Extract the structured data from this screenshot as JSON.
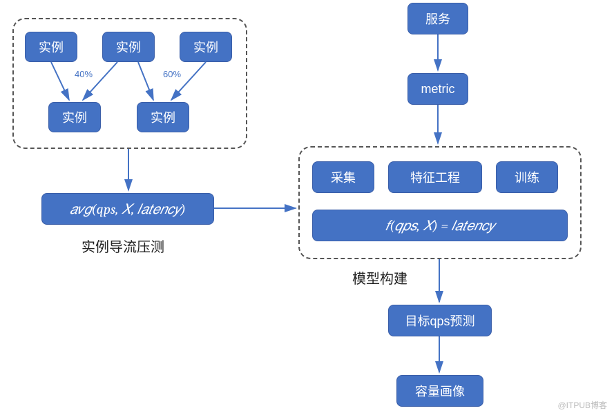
{
  "left_group": {
    "instance1": "实例",
    "instance2": "实例",
    "instance3": "实例",
    "instance4": "实例",
    "instance5": "实例",
    "pct_left": "40%",
    "pct_right": "60%"
  },
  "avg_box": "𝑎𝑣𝑔(qps, 𝑋, 𝑙𝑎𝑡𝑒𝑛𝑐𝑦)",
  "left_caption": "实例导流压测",
  "right_top": {
    "service": "服务",
    "metric": "metric"
  },
  "model_group": {
    "collect": "采集",
    "feature": "特征工程",
    "train": "训练",
    "formula": "𝑓(𝑞𝑝𝑠, 𝑋) = 𝑙𝑎𝑡𝑒𝑛𝑐𝑦"
  },
  "model_caption": "模型构建",
  "predict": "目标qps预测",
  "capacity": "容量画像",
  "watermark": "@ITPUB博客"
}
